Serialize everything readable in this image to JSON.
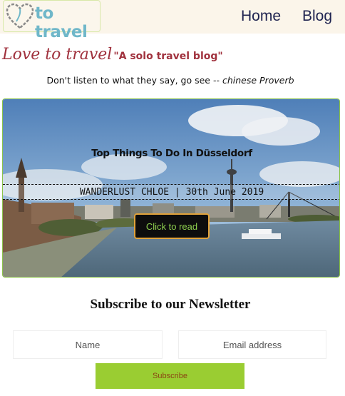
{
  "navbar": {
    "logo_text": "to travel",
    "links": [
      {
        "label": "Home"
      },
      {
        "label": "Blog"
      }
    ]
  },
  "header": {
    "title": "Love to travel",
    "tagline": "\"A solo travel blog\""
  },
  "quote": {
    "text": "Don't listen to what they say, go see -- ",
    "source": "chinese Proverb"
  },
  "hero": {
    "title": "Top Things To Do In Düsseldorf",
    "meta": "WANDERLUST CHLOE | 30th June 2019",
    "button_label": "Click to read"
  },
  "newsletter": {
    "title": "Subscribe to our Newsletter",
    "name_placeholder": "Name",
    "email_placeholder": "Email address",
    "button_label": "Subscribe"
  },
  "colors": {
    "navbar_bg": "#fbf5ea",
    "logo_text": "#6fb7c9",
    "title_red": "#a0313d",
    "hero_border": "#8bc34a",
    "read_button_text": "#8fd14f",
    "read_button_border": "#e2a33a",
    "subscribe_bg": "#9acd32",
    "subscribe_text": "#8b4513"
  }
}
